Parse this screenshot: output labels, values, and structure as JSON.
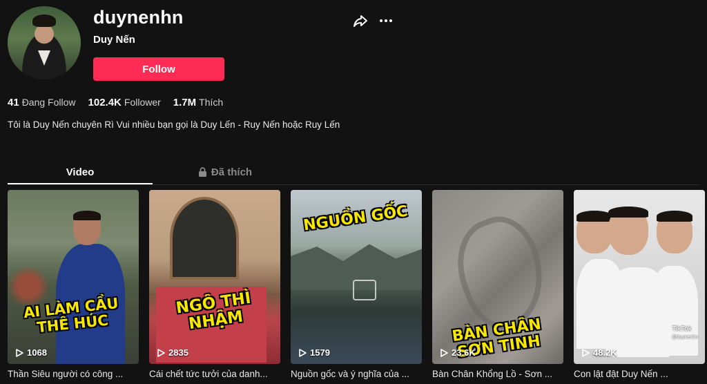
{
  "profile": {
    "username": "duynenhn",
    "nickname": "Duy Nến",
    "follow_label": "Follow",
    "bio": "Tôi là Duy Nến chuyên Rì Vui nhiều bạn gọi là Duy Lến - Ruy Nến hoặc Ruy Lến"
  },
  "stats": [
    {
      "value": "41",
      "label": "Đang Follow"
    },
    {
      "value": "102.4K",
      "label": "Follower"
    },
    {
      "value": "1.7M",
      "label": "Thích"
    }
  ],
  "tabs": [
    {
      "label": "Video",
      "active": true
    },
    {
      "label": "Đã thích",
      "icon": "lock-icon",
      "active": false
    }
  ],
  "videos": [
    {
      "views": "1068",
      "caption": "Thần Siêu người có công ...",
      "overlay": "AI LÀM CẦU\nTHÊ HÚC"
    },
    {
      "views": "2835",
      "caption": "Cái chết tức tưởi của danh...",
      "overlay": "NGÔ THÌ\nNHẬM"
    },
    {
      "views": "1579",
      "caption": "Nguồn gốc và ý nghĩa của ...",
      "overlay": "NGUỒN GỐC"
    },
    {
      "views": "23.6K",
      "caption": "Bàn Chân Khổng Lồ - Sơn ...",
      "overlay": "BÀN CHÂN\nSƠN TINH"
    },
    {
      "views": "48.2K",
      "caption": "Con lật đật Duy Nến ...",
      "overlay": ""
    }
  ],
  "watermark": {
    "brand": "TikTok",
    "handle": "@duynenhn"
  },
  "icons": {
    "share": "share-icon",
    "more": "more-icon",
    "play": "play-icon",
    "lock": "lock-icon"
  },
  "colors": {
    "accent": "#fe2c55",
    "background": "#121212"
  }
}
